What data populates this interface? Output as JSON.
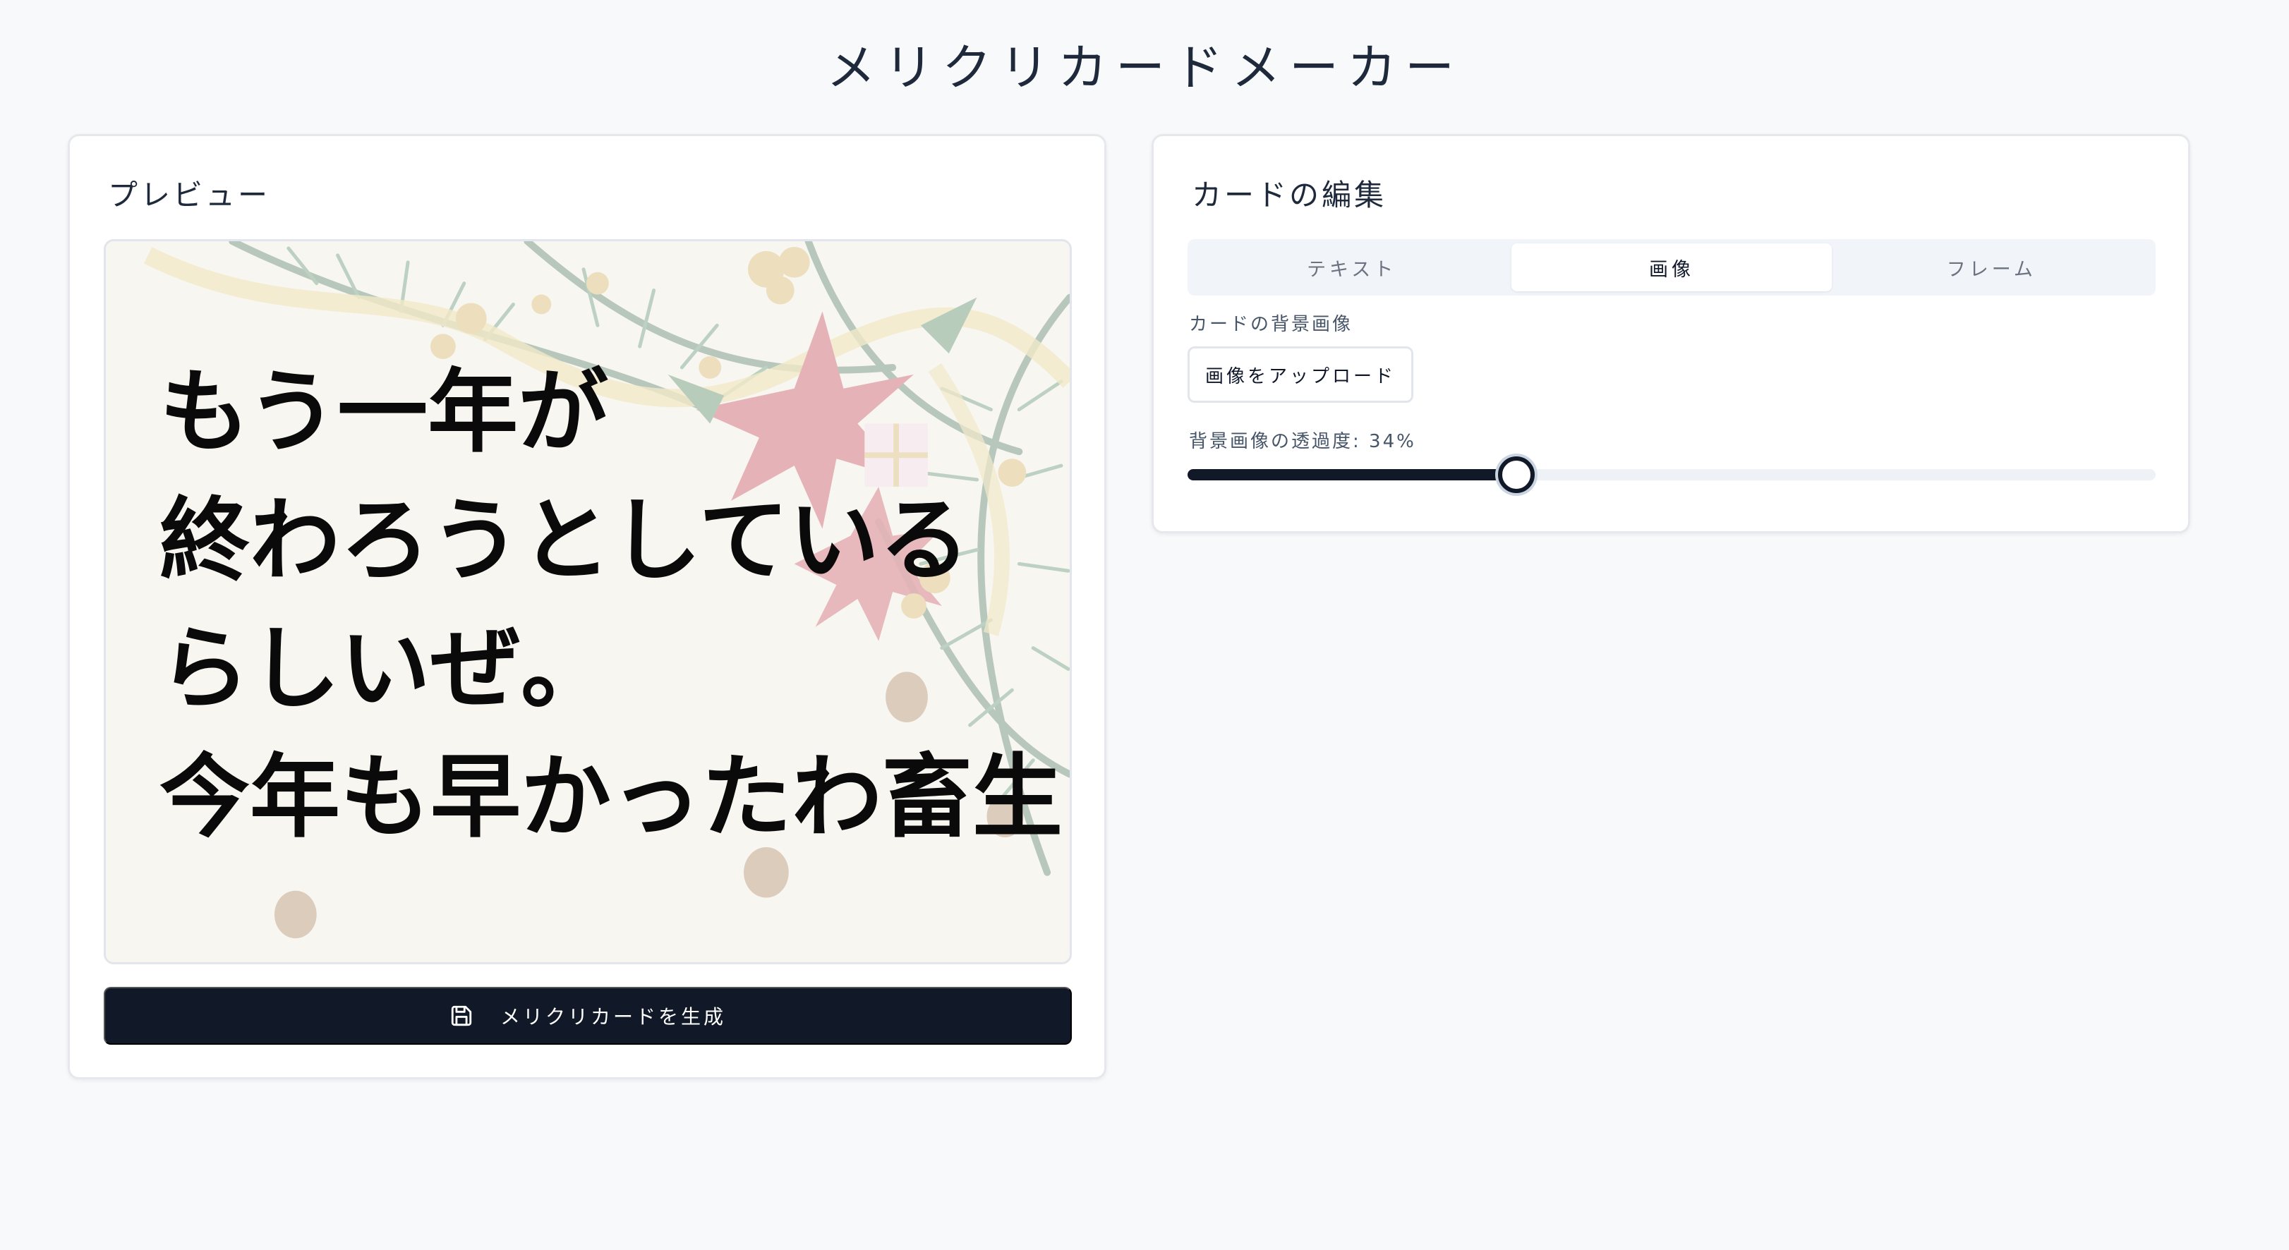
{
  "app": {
    "title": "メリクリカードメーカー"
  },
  "preview": {
    "title": "プレビュー",
    "card_lines": [
      "もう一年が",
      "終わろうとしている",
      "らしいぜ。",
      "今年も早かったわ畜生"
    ],
    "background_opacity": 0.34,
    "generate_label": "メリクリカードを生成",
    "generate_icon": "save-icon"
  },
  "editor": {
    "title": "カードの編集",
    "tabs": [
      {
        "label": "テキスト",
        "active": false
      },
      {
        "label": "画像",
        "active": true
      },
      {
        "label": "フレーム",
        "active": false
      }
    ],
    "bg_image_label": "カードの背景画像",
    "upload_label": "画像をアップロード",
    "opacity_label": "背景画像の透過度: 34%",
    "opacity_value": 34
  },
  "colors": {
    "primary": "#111827",
    "page_bg": "#f8f9fb",
    "panel_border": "#e6e8ee"
  }
}
